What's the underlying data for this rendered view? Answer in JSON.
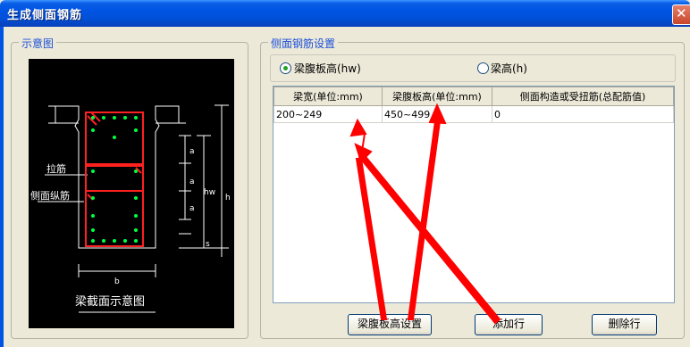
{
  "window": {
    "title": "生成侧面钢筋",
    "close_glyph": "✕"
  },
  "left_group": {
    "title": "示意图",
    "diagram": {
      "label_tie": "拉筋",
      "label_side_bar": "侧面纵筋",
      "caption": "梁截面示意图",
      "dim_a": "a",
      "dim_hw": "hw",
      "dim_h": "h",
      "dim_s": "s",
      "dim_b": "b"
    }
  },
  "right_group": {
    "title": "侧面钢筋设置",
    "radio_hw": "梁腹板高(hw)",
    "radio_h": "梁高(h)",
    "selected": "hw"
  },
  "table": {
    "columns": [
      "梁宽(单位:mm)",
      "梁腹板高(单位:mm)",
      "侧面构造或受扭筋(总配筋值)"
    ],
    "rows": [
      [
        "200~249",
        "450~499",
        "0"
      ]
    ]
  },
  "buttons": {
    "web_height": "梁腹板高设置",
    "add_row": "添加行",
    "delete_row": "删除行"
  },
  "annotation_color": "#ff0000"
}
